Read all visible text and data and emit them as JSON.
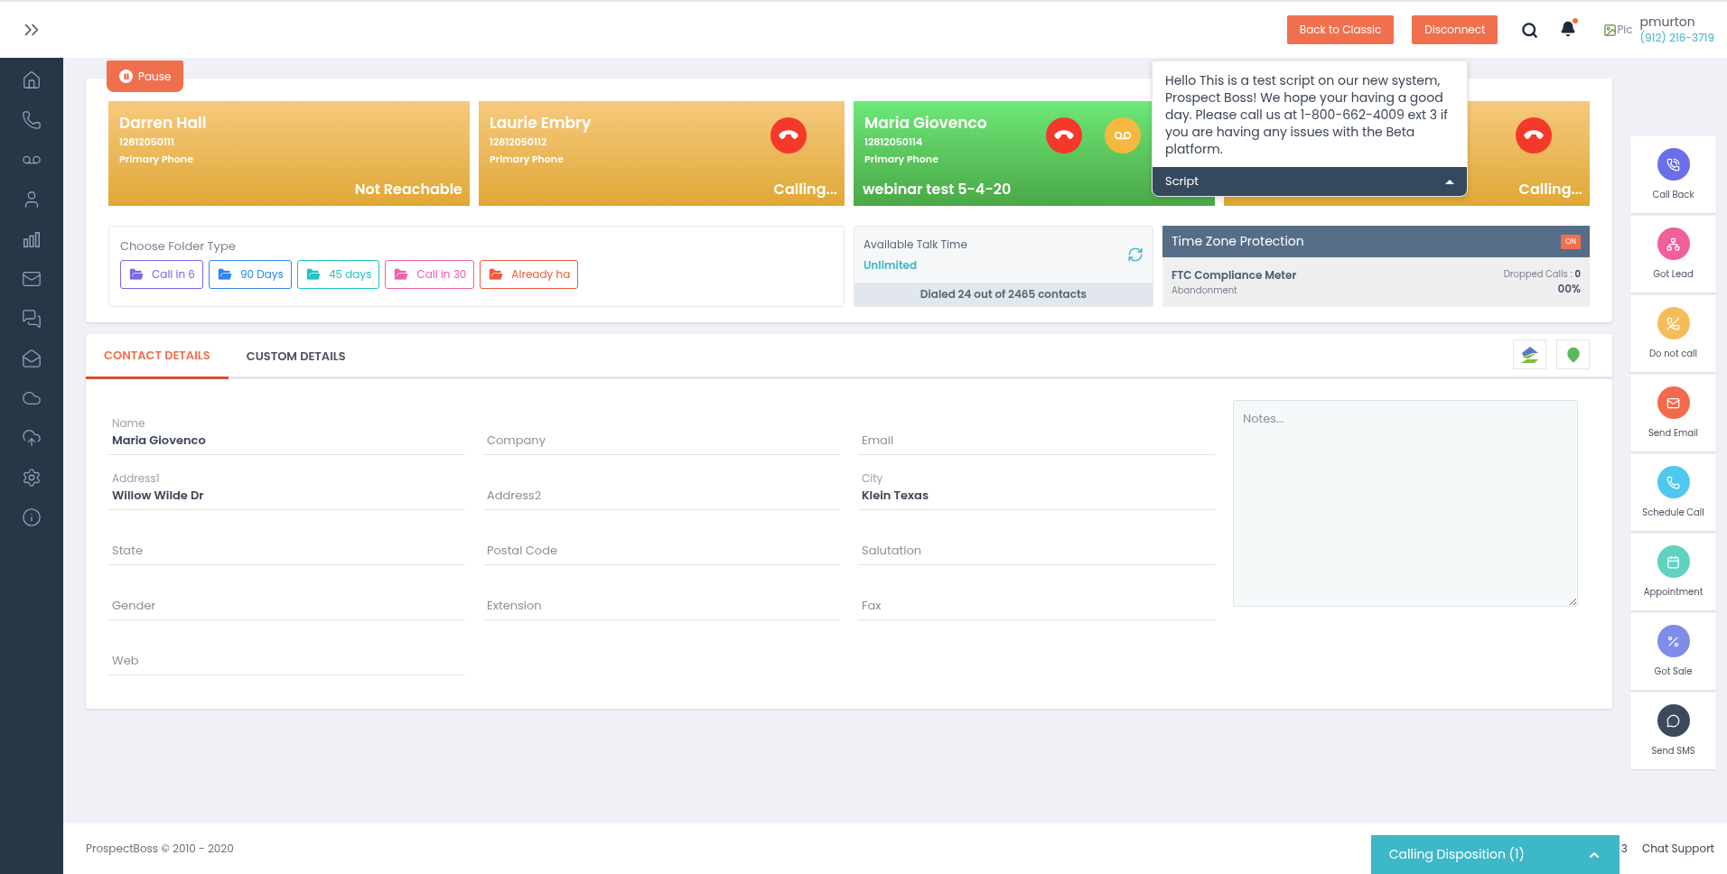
{
  "topbar": {
    "buttons": [
      "Back to Classic",
      "Disconnect"
    ],
    "notification_dot": true,
    "avatar_alt": "Pic",
    "user": {
      "name": "pmurton",
      "phone": "(912) 216-3719"
    }
  },
  "sidebar": {
    "items": [
      {
        "kind": "home"
      },
      {
        "kind": "phone"
      },
      {
        "kind": "voicemail"
      },
      {
        "kind": "user"
      },
      {
        "kind": "chart"
      },
      {
        "kind": "mail"
      },
      {
        "kind": "chat"
      },
      {
        "kind": "inbox"
      },
      {
        "kind": "cloud"
      },
      {
        "kind": "upload"
      },
      {
        "kind": "settings"
      },
      {
        "kind": "info"
      }
    ]
  },
  "pause_button": "Pause",
  "call_cards": [
    {
      "name": "Darren Hall",
      "number": "12812050111",
      "phone_type": "Primary Phone",
      "status": "Not Reachable",
      "kind": "waiting",
      "hangup": false,
      "voicemail": false
    },
    {
      "name": "Laurie Embry",
      "number": "12812050112",
      "phone_type": "Primary Phone",
      "status": "Calling...",
      "kind": "waiting",
      "hangup": true,
      "voicemail": false
    },
    {
      "name": "Maria Giovenco",
      "number": "12812050114",
      "phone_type": "Primary Phone",
      "status": "webinar test 5-4-20",
      "kind": "connected",
      "hangup": true,
      "voicemail": true
    },
    {
      "status": "Calling...",
      "kind": "waiting",
      "hangup": true,
      "voicemail": false
    }
  ],
  "script": {
    "text": "Hello This is a test script on our new system, Prospect Boss! We hope your having a good day. Please call us at 1-800-662-4009 ext 3 if you are having any issues with the Beta platform.",
    "label": "Script",
    "expanded": true
  },
  "folders": {
    "title": "Choose Folder Type",
    "items": [
      {
        "label": "Call in 6",
        "color": "#7b68ee"
      },
      {
        "label": "90 Days",
        "color": "#2e86f0"
      },
      {
        "label": "45 days",
        "color": "#1fc4c4"
      },
      {
        "label": "Call in 30",
        "color": "#f062a8"
      },
      {
        "label": "Already ha",
        "color": "#f05a3c"
      }
    ]
  },
  "talk_time": {
    "label": "Available Talk Time",
    "value": "Unlimited",
    "dialed": "Dialed 24 out of 2465 contacts"
  },
  "time_zone": {
    "title": "Time Zone Protection",
    "toggle": "ON",
    "on": true,
    "meter": "FTC Compliance Meter",
    "meter_sub": "Abandonment",
    "dropped_label": "Dropped Calls :",
    "dropped_value": "0",
    "percent": "00%"
  },
  "tabs": [
    {
      "label": "CONTACT DETAILS",
      "selected": true
    },
    {
      "label": "CUSTOM DETAILS",
      "selected": false
    }
  ],
  "fields": [
    {
      "label": "Name",
      "value": "Maria Giovenco"
    },
    {
      "label": "Company"
    },
    {
      "label": "Email"
    },
    {
      "label": "Address1",
      "value": "Willow Wilde Dr"
    },
    {
      "label": "Address2"
    },
    {
      "label": "City",
      "value": "Klein Texas"
    },
    {
      "label": "State"
    },
    {
      "label": "Postal Code"
    },
    {
      "label": "Salutation"
    },
    {
      "label": "Gender"
    },
    {
      "label": "Extension"
    },
    {
      "label": "Fax"
    },
    {
      "label": "Web"
    }
  ],
  "notes": {
    "placeholder": "Notes..."
  },
  "actions": [
    {
      "label": "Call Back",
      "kind": "callback",
      "color": "#6a6ee8"
    },
    {
      "label": "Got Lead",
      "kind": "lead",
      "color": "#f0609a"
    },
    {
      "label": "Do not call",
      "kind": "dnc",
      "color": "#f5bd5a"
    },
    {
      "label": "Send Email",
      "kind": "email",
      "color": "#f26a4b"
    },
    {
      "label": "Schedule Call",
      "kind": "schedule",
      "color": "#4fc8ef"
    },
    {
      "label": "Appointment",
      "kind": "appointment",
      "color": "#5fd3c0"
    },
    {
      "label": "Got Sale",
      "kind": "sale",
      "color": "#7f8de8"
    },
    {
      "label": "Send SMS",
      "kind": "sms",
      "color": "#3c4a5c"
    }
  ],
  "footer": {
    "copyright": "ProspectBoss © 2010 - 2020",
    "disposition": "Calling Disposition (1)",
    "hidden_count": "3",
    "chat": "Chat Support"
  }
}
